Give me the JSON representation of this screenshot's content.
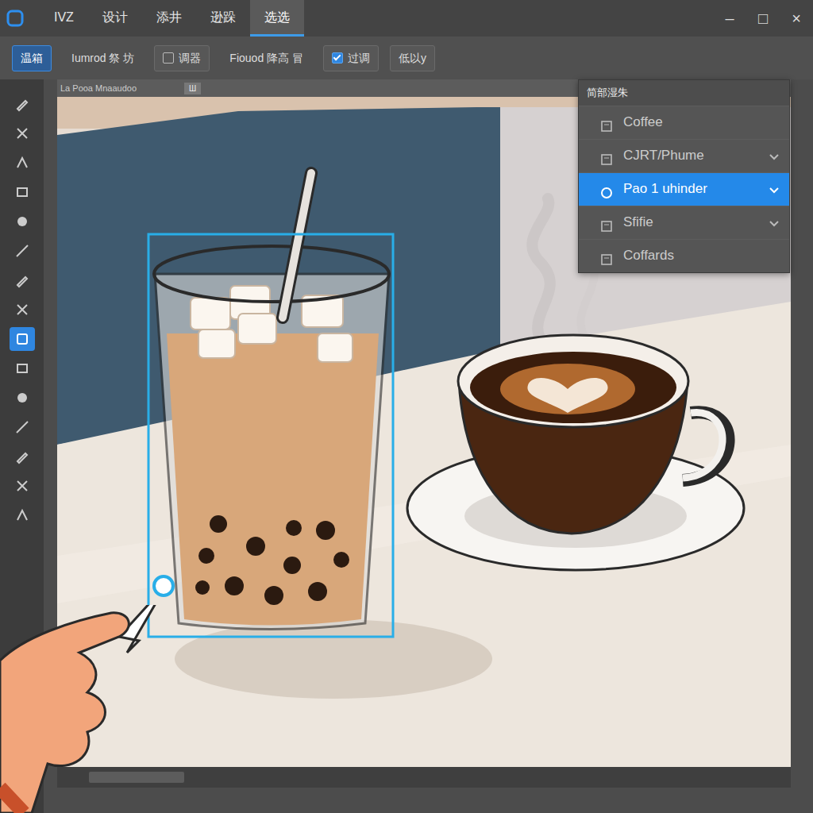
{
  "tabs": [
    {
      "label": "IVZ",
      "selected": false
    },
    {
      "label": "设计",
      "selected": false
    },
    {
      "label": "添井",
      "selected": false
    },
    {
      "label": "逊跺",
      "selected": false
    },
    {
      "label": "选选",
      "selected": true
    }
  ],
  "window_controls": [
    "–",
    "□",
    "×"
  ],
  "toolbar": [
    {
      "kind": "button",
      "label": "温箱",
      "selected": true
    },
    {
      "kind": "label",
      "label": "Iumrod 祭 坊"
    },
    {
      "kind": "checkbox",
      "label": "调器",
      "checked": false
    },
    {
      "kind": "label",
      "label": "Fiouod 降高 冒"
    },
    {
      "kind": "checkbox",
      "label": "过调",
      "checked": true
    },
    {
      "kind": "button",
      "label": "低以y",
      "selected": false
    }
  ],
  "tools": [
    {
      "selected": false
    },
    {
      "selected": false
    },
    {
      "selected": false
    },
    {
      "selected": false
    },
    {
      "selected": false
    },
    {
      "selected": false
    },
    {
      "selected": false
    },
    {
      "selected": false
    },
    {
      "selected": true
    },
    {
      "selected": false
    },
    {
      "selected": false
    },
    {
      "selected": false
    },
    {
      "selected": false
    },
    {
      "selected": false
    },
    {
      "selected": false
    }
  ],
  "document": {
    "ruler_label": "La Pooa Mnaaudoo",
    "tab": "Ш"
  },
  "layers_panel": {
    "title": "简部湿朱",
    "items": [
      {
        "label": "Coffee",
        "selected": false,
        "expandable": false
      },
      {
        "label": "CJRT/Phume",
        "selected": false,
        "expandable": true
      },
      {
        "label": "Pao 1 uhinder",
        "selected": true,
        "expandable": true
      },
      {
        "label": "Sfifie",
        "selected": false,
        "expandable": true
      },
      {
        "label": "Coffards",
        "selected": false,
        "expandable": false
      }
    ]
  }
}
